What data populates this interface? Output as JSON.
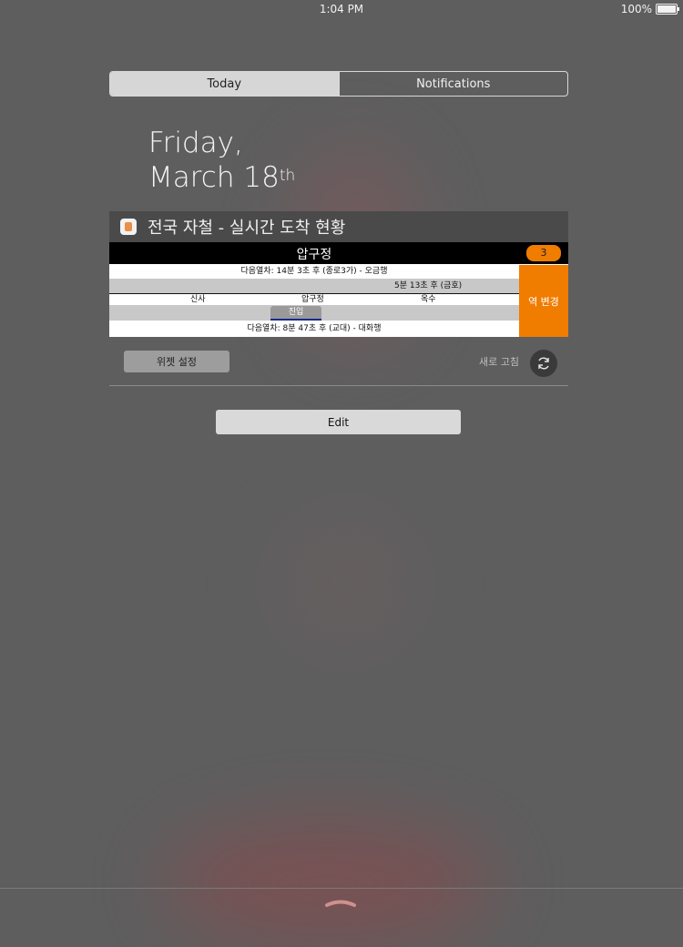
{
  "status_bar": {
    "time": "1:04 PM",
    "battery": "100%"
  },
  "segments": {
    "today": "Today",
    "notifications": "Notifications"
  },
  "date": {
    "line1": "Friday,",
    "line2": "March 18",
    "suffix": "th"
  },
  "widget": {
    "title": "전국 자철 - 실시간 도착 현황",
    "station": "압구정",
    "count": "3",
    "next_train_1": "다음열차: 14분 3초 후 (종로3가) - 오금행",
    "next_train_2": "5분 13초 후 (금호)",
    "stations": {
      "prev": "신사",
      "current": "압구정",
      "next": "옥수"
    },
    "entering": "진입",
    "next_train_3": "다음열차: 8분 47초 후 (교대) - 대화행",
    "change_station": "역 변경",
    "settings_button": "위젯 설정",
    "refresh_label": "새로 고침"
  },
  "edit_button": "Edit",
  "colors": {
    "accent": "#f07c00",
    "background": "#5e5e5f"
  },
  "icons": {
    "app": "subway-app-icon",
    "refresh": "refresh-icon",
    "handle": "chevron-up-handle-icon"
  }
}
